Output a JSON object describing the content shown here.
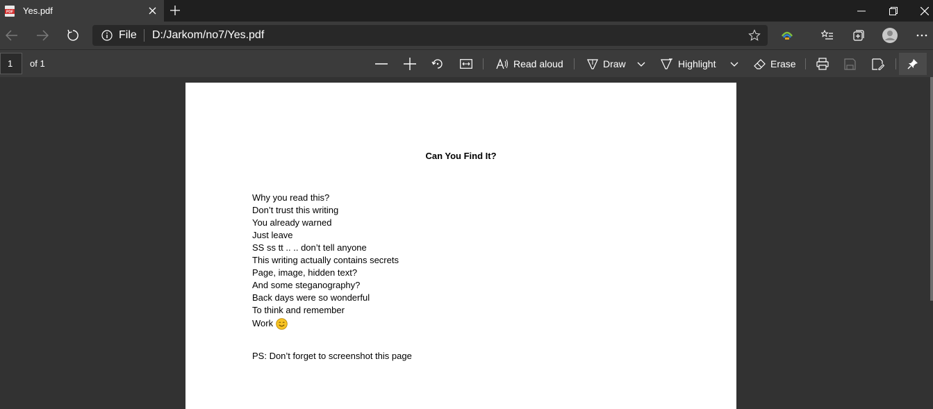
{
  "tab": {
    "title": "Yes.pdf",
    "icon": "pdf-file-icon"
  },
  "address": {
    "scheme_label": "File",
    "url": "D:/Jarkom/no7/Yes.pdf"
  },
  "pdf_toolbar": {
    "page_number": "1",
    "page_of": "of 1",
    "read_aloud": "Read aloud",
    "draw": "Draw",
    "highlight": "Highlight",
    "erase": "Erase"
  },
  "document": {
    "title": "Can You Find It?",
    "lines": [
      "Why you read this?",
      "Don’t trust this writing",
      "You already warned",
      "Just leave",
      "SS ss tt .. .. don’t tell anyone",
      "This writing actually contains secrets",
      "Page, image, hidden text?",
      "And some steganography?",
      "Back days were so wonderful",
      "To think and remember"
    ],
    "last_line": "Work",
    "ps": "PS: Don’t forget to screenshot this page"
  },
  "colors": {
    "chrome_dark": "#1f1f1f",
    "toolbar": "#3b3b3b",
    "viewer_bg": "#323232",
    "page": "#ffffff"
  }
}
